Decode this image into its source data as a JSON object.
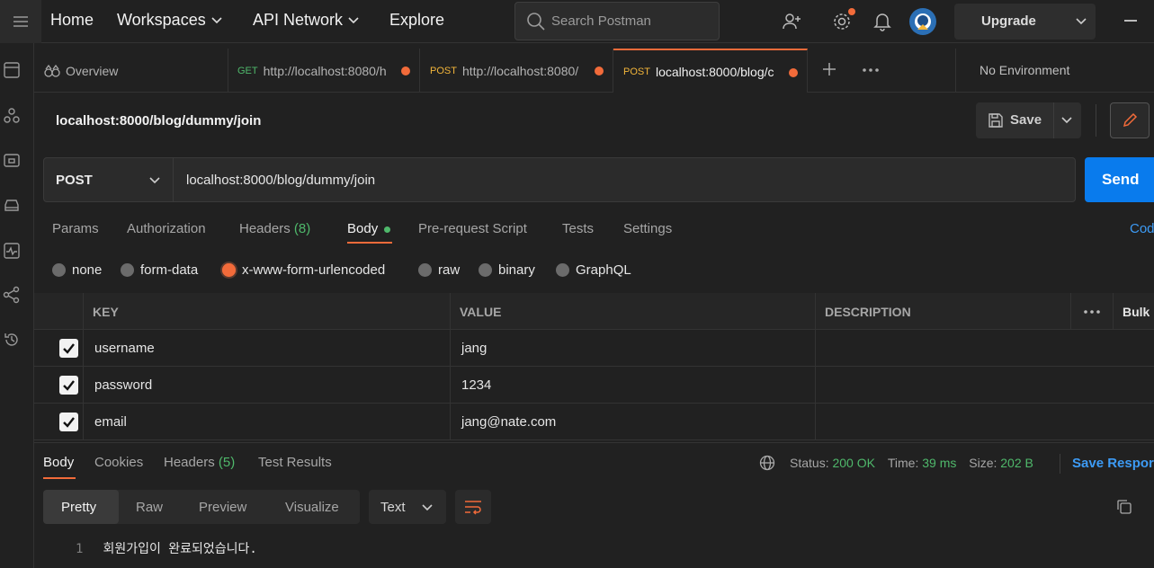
{
  "header": {
    "nav": [
      "Home",
      "Workspaces",
      "API Network",
      "Explore"
    ],
    "search_placeholder": "Search Postman",
    "upgrade_label": "Upgrade"
  },
  "tabs": [
    {
      "label": "Overview"
    },
    {
      "method": "GET",
      "url": "http://localhost:8080/h"
    },
    {
      "method": "POST",
      "url": "http://localhost:8080/"
    },
    {
      "method": "POST",
      "url": "localhost:8000/blog/c"
    }
  ],
  "environment": "No Environment",
  "request": {
    "title": "localhost:8000/blog/dummy/join",
    "save_label": "Save",
    "method": "POST",
    "url": "localhost:8000/blog/dummy/join",
    "send_label": "Send"
  },
  "request_tabs": {
    "params": "Params",
    "authorization": "Authorization",
    "headers": "Headers",
    "headers_count": "(8)",
    "body": "Body",
    "prerequest": "Pre-request Script",
    "tests": "Tests",
    "settings": "Settings",
    "code": "Cod"
  },
  "body_modes": [
    "none",
    "form-data",
    "x-www-form-urlencoded",
    "raw",
    "binary",
    "GraphQL"
  ],
  "kv_table": {
    "headers": {
      "key": "KEY",
      "value": "VALUE",
      "description": "DESCRIPTION",
      "bulk": "Bulk"
    },
    "rows": [
      {
        "key": "username",
        "value": "jang"
      },
      {
        "key": "password",
        "value": "1234"
      },
      {
        "key": "email",
        "value": "jang@nate.com"
      }
    ]
  },
  "response": {
    "tabs": {
      "body": "Body",
      "cookies": "Cookies",
      "headers": "Headers",
      "headers_count": "(5)",
      "tests": "Test Results"
    },
    "status_label": "Status:",
    "status_value": "200 OK",
    "time_label": "Time:",
    "time_value": "39 ms",
    "size_label": "Size:",
    "size_value": "202 B",
    "save_label": "Save Respor",
    "view_options": [
      "Pretty",
      "Raw",
      "Preview",
      "Visualize"
    ],
    "format": "Text",
    "line_number": "1",
    "line_text": "회원가입이 완료되었습니다."
  },
  "colors": {
    "accent": "#f26b3a",
    "send": "#097bed",
    "success": "#4fb86b"
  }
}
